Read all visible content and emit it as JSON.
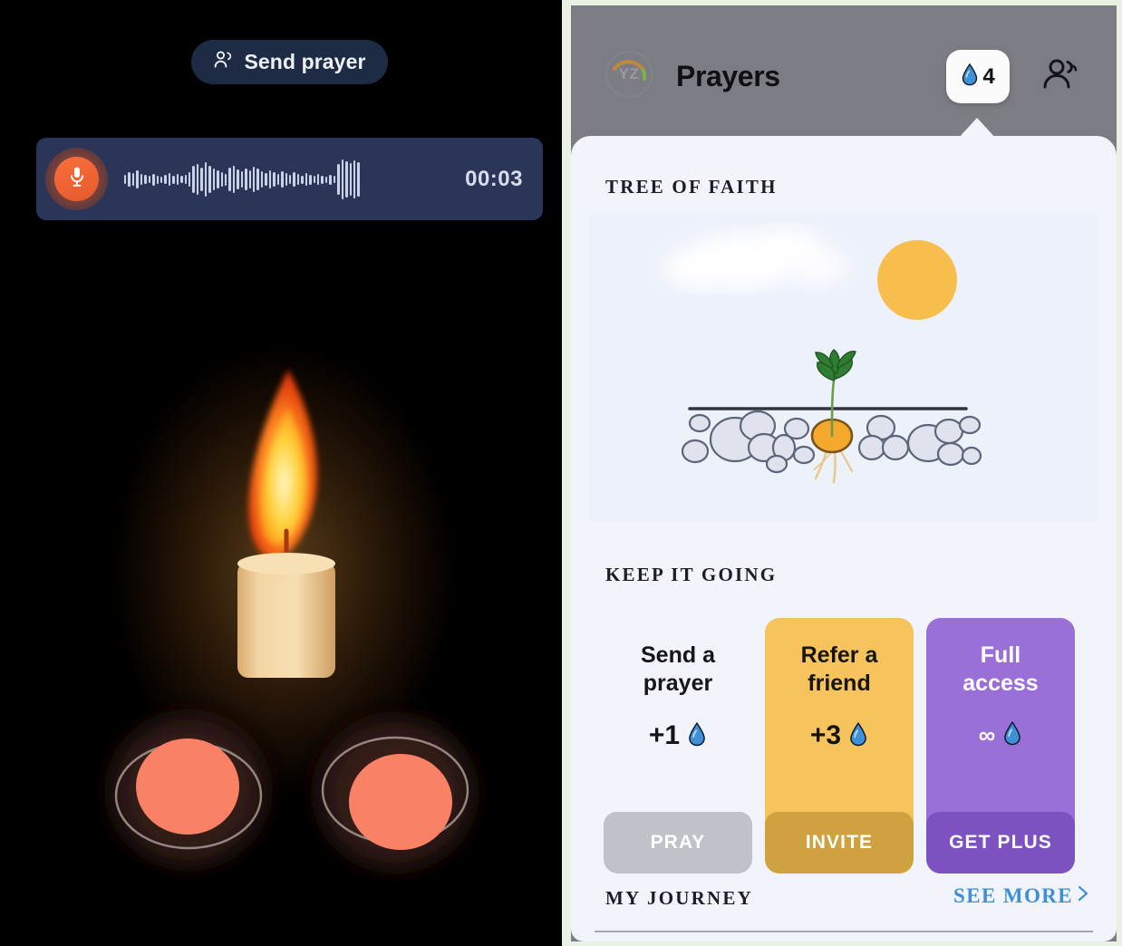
{
  "left_panel": {
    "send_prayer_button": {
      "label": "Send prayer",
      "icon": "people-icon"
    },
    "voice_note": {
      "mic_icon": "microphone-icon",
      "duration": "00:03",
      "waveform_heights": [
        10,
        16,
        14,
        20,
        12,
        10,
        8,
        13,
        9,
        7,
        10,
        14,
        9,
        12,
        8,
        10,
        16,
        30,
        34,
        26,
        38,
        30,
        24,
        20,
        16,
        13,
        26,
        30,
        22,
        18,
        24,
        20,
        28,
        24,
        18,
        14,
        20,
        16,
        12,
        18,
        14,
        10,
        16,
        12,
        9,
        14,
        11,
        8,
        12,
        9,
        7,
        11,
        8,
        34,
        44,
        40,
        36,
        42,
        38
      ]
    },
    "scene": {
      "flame_outer_color": "#ff5b1f",
      "flame_inner_color": "#ffd34d",
      "candle_color": "#f0cf9a",
      "avatar_fill": "#f98165",
      "avatar_ring": "#b4a7a1"
    }
  },
  "right_panel": {
    "header": {
      "avatar_initials": "YZ",
      "title": "Prayers",
      "drops_badge": {
        "icon": "water-drop-icon",
        "count": "4"
      },
      "friends_button_icon": "people-icon"
    },
    "sheet": {
      "tree_section_label": "TREE OF FAITH",
      "tree_illustration": {
        "sun_color": "#f7bd4d",
        "cloud_color": "#ffffff",
        "ground_line_color": "#2e3440",
        "sprout_color": "#2f7d32",
        "seed_color": "#f4a92c",
        "root_color": "#e5c98c",
        "rock_stroke": "#5d6579",
        "rock_fill": "#dcdfeb",
        "background": "#edf1fa"
      },
      "keep_going_label": "KEEP IT GOING",
      "cards": [
        {
          "id": "send-a-prayer",
          "title": "Send a\nprayer",
          "title_line1": "Send a",
          "title_line2": "prayer",
          "reward": "+1",
          "reward_icon": "water-drop-icon",
          "cta": "PRAY",
          "bg": "#f2f4fb",
          "cta_bg": "#bfc2c9"
        },
        {
          "id": "refer-a-friend",
          "title_line1": "Refer a",
          "title_line2": "friend",
          "reward": "+3",
          "reward_icon": "water-drop-icon",
          "cta": "INVITE",
          "bg": "#f7c35c",
          "cta_bg": "#cfa13f"
        },
        {
          "id": "full-access",
          "title_line1": "Full",
          "title_line2": "access",
          "reward": "∞",
          "reward_icon": "water-drop-icon",
          "cta": "GET PLUS",
          "bg": "#9b6fd8",
          "cta_bg": "#7d51c0"
        }
      ],
      "journey_label": "MY JOURNEY",
      "see_more_label": "SEE MORE",
      "see_more_icon": "chevron-right-icon"
    }
  }
}
